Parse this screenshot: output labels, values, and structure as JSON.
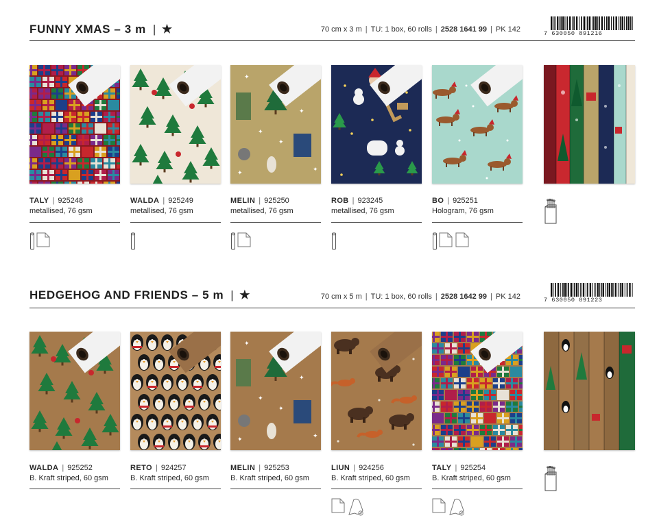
{
  "sections": [
    {
      "title": "FUNNY XMAS – 3 m",
      "star": "★",
      "meta": {
        "size": "70 cm x 3 m",
        "tu": "TU: 1 box, 60 rolls",
        "code": "2528 1641 99",
        "pk": "PK 142"
      },
      "barcode_number": "7 630050 891216",
      "products": [
        {
          "name": "TALY",
          "sku": "925248",
          "material": "metallised, 76 gsm",
          "pattern": "gifts",
          "icons": [
            "roll-icon",
            "sheet-icon"
          ]
        },
        {
          "name": "WALDA",
          "sku": "925249",
          "material": "metallised, 76 gsm",
          "pattern": "trees-cream",
          "icons": [
            "roll-icon"
          ]
        },
        {
          "name": "MELIN",
          "sku": "925250",
          "material": "metallised, 76 gsm",
          "pattern": "animals-gold",
          "icons": [
            "roll-icon",
            "sheet-icon"
          ]
        },
        {
          "name": "ROB",
          "sku": "923245",
          "material": "metallised, 76 gsm",
          "pattern": "navy-night",
          "icons": [
            "roll-icon"
          ]
        },
        {
          "name": "BO",
          "sku": "925251",
          "material": "Hologram, 76 gsm",
          "pattern": "dogs-mint",
          "icons": [
            "roll-icon",
            "sheet-icon",
            "sheet-icon"
          ]
        }
      ]
    },
    {
      "title": "HEDGEHOG AND FRIENDS – 5 m",
      "star": "★",
      "meta": {
        "size": "70 cm x 5 m",
        "tu": "TU: 1 box, 60 rolls",
        "code": "2528 1642 99",
        "pk": "PK 142"
      },
      "barcode_number": "7 630050 891223",
      "products": [
        {
          "name": "WALDA",
          "sku": "925252",
          "material": "B. Kraft striped, 60 gsm",
          "pattern": "trees-kraft",
          "icons": []
        },
        {
          "name": "RETO",
          "sku": "924257",
          "material": "B. Kraft striped, 60 gsm",
          "pattern": "penguins",
          "icons": []
        },
        {
          "name": "MELIN",
          "sku": "925253",
          "material": "B. Kraft striped, 60 gsm",
          "pattern": "animals-kraft",
          "icons": []
        },
        {
          "name": "LIUN",
          "sku": "924256",
          "material": "B. Kraft striped, 60 gsm",
          "pattern": "bears-kraft",
          "icons": [
            "sheet-icon",
            "recycle-roll-icon"
          ]
        },
        {
          "name": "TALY",
          "sku": "925254",
          "material": "B. Kraft striped, 60 gsm",
          "pattern": "gifts-kraft",
          "icons": [
            "sheet-icon",
            "recycle-roll-icon"
          ]
        }
      ]
    }
  ],
  "separator": "|",
  "colors": {
    "text": "#2a2a2a",
    "rule": "#333333",
    "red": "#c8272d",
    "green": "#1f7a3d",
    "navy": "#1c2a55",
    "mint": "#a9d8cc",
    "kraft": "#a57a4c",
    "gold": "#b9a46a",
    "cream": "#efe7d8"
  }
}
